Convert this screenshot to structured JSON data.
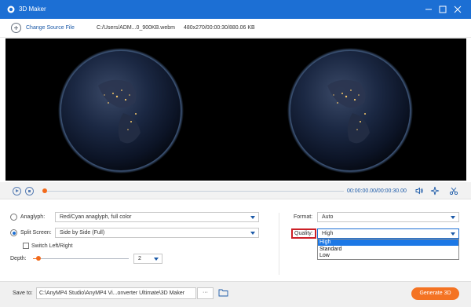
{
  "window": {
    "title": "3D Maker"
  },
  "source": {
    "change_label": "Change Source File",
    "file_path": "C:/Users/ADM...0_900KB.webm",
    "file_info": "480x270/00:00:30/880.06 KB"
  },
  "player": {
    "timecode": "00:00:00.00/00:00:30.00",
    "progress_fraction": 0.0
  },
  "settings": {
    "anaglyph": {
      "label": "Anaglyph:",
      "value": "Red/Cyan anaglyph, full color",
      "checked": false
    },
    "split_screen": {
      "label": "Split Screen:",
      "value": "Side by Side (Full)",
      "checked": true
    },
    "switch_lr": {
      "label": "Switch Left/Right",
      "checked": false
    },
    "depth": {
      "label": "Depth:",
      "value": "2",
      "level_fraction": 0.04
    },
    "format": {
      "label": "Format:",
      "value": "Auto"
    },
    "quality": {
      "label": "Quality:",
      "value": "High",
      "options": [
        "High",
        "Standard",
        "Low"
      ],
      "highlight_color": "#cc2027"
    }
  },
  "bottom": {
    "save_to_label": "Save to:",
    "save_path": "C:\\AnyMP4 Studio\\AnyMP4 Vi...onverter Ultimate\\3D Maker",
    "more_label": "···",
    "generate_label": "Generate 3D"
  },
  "colors": {
    "titlebar": "#1c6fd4",
    "accent": "#f47323",
    "link": "#1c5aa8"
  }
}
